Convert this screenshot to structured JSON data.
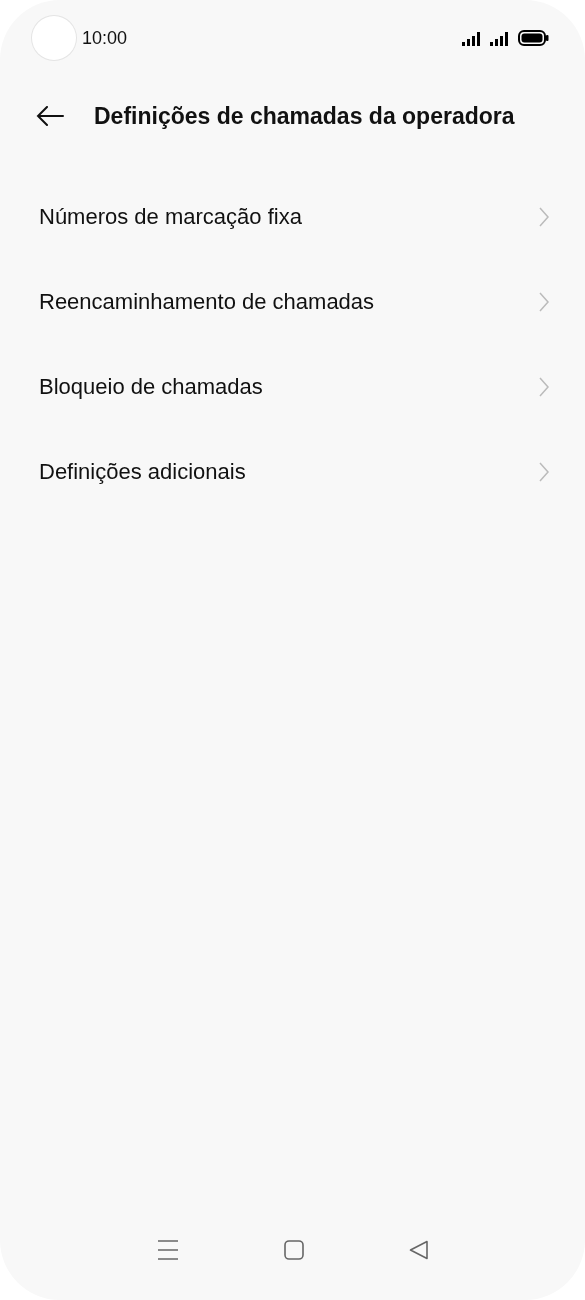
{
  "status_bar": {
    "time": "10:00"
  },
  "header": {
    "title": "Definições de chamadas da operadora"
  },
  "items": [
    {
      "label": "Números de marcação fixa"
    },
    {
      "label": "Reencaminhamento de chamadas"
    },
    {
      "label": "Bloqueio de chamadas"
    },
    {
      "label": "Definições adicionais"
    }
  ]
}
